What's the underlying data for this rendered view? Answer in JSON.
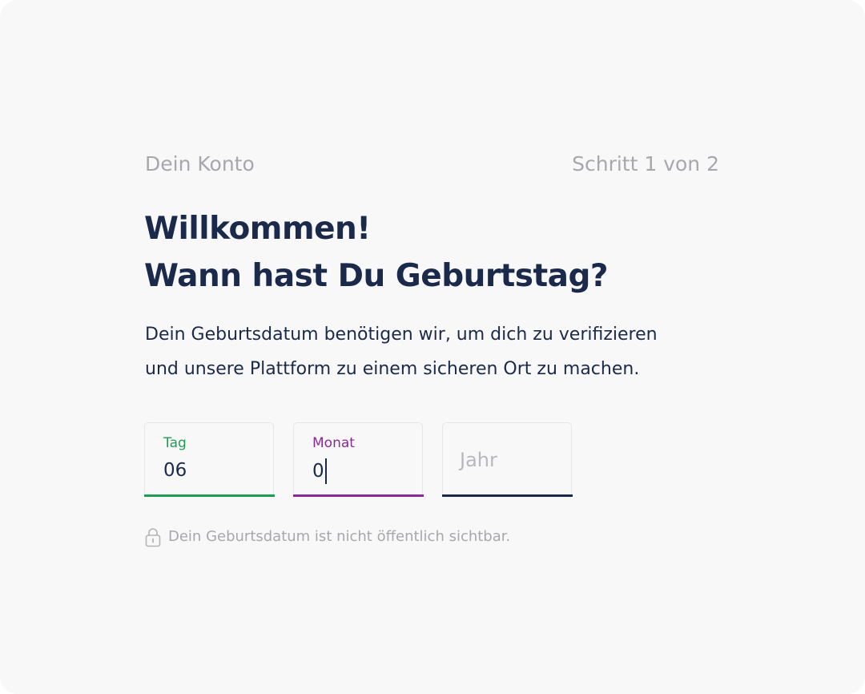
{
  "header": {
    "section_label": "Dein Konto",
    "step_label": "Schritt 1 von 2"
  },
  "title": {
    "line1": "Willkommen!",
    "line2": "Wann hast Du Geburtstag?"
  },
  "description": {
    "line1": "Dein Geburtsdatum benötigen wir, um dich zu verifizieren",
    "line2": "und unsere Plattform zu einem sicheren Ort zu machen."
  },
  "fields": {
    "day": {
      "label": "Tag",
      "value": "06",
      "accent": "#1e9e55"
    },
    "month": {
      "label": "Monat",
      "value": "0",
      "accent": "#8c2a95",
      "focused": true
    },
    "year": {
      "placeholder": "Jahr",
      "accent": "#1b2a4a"
    }
  },
  "hint": {
    "icon": "lock-icon",
    "text": "Dein Geburtsdatum ist nicht öffentlich sichtbar."
  }
}
